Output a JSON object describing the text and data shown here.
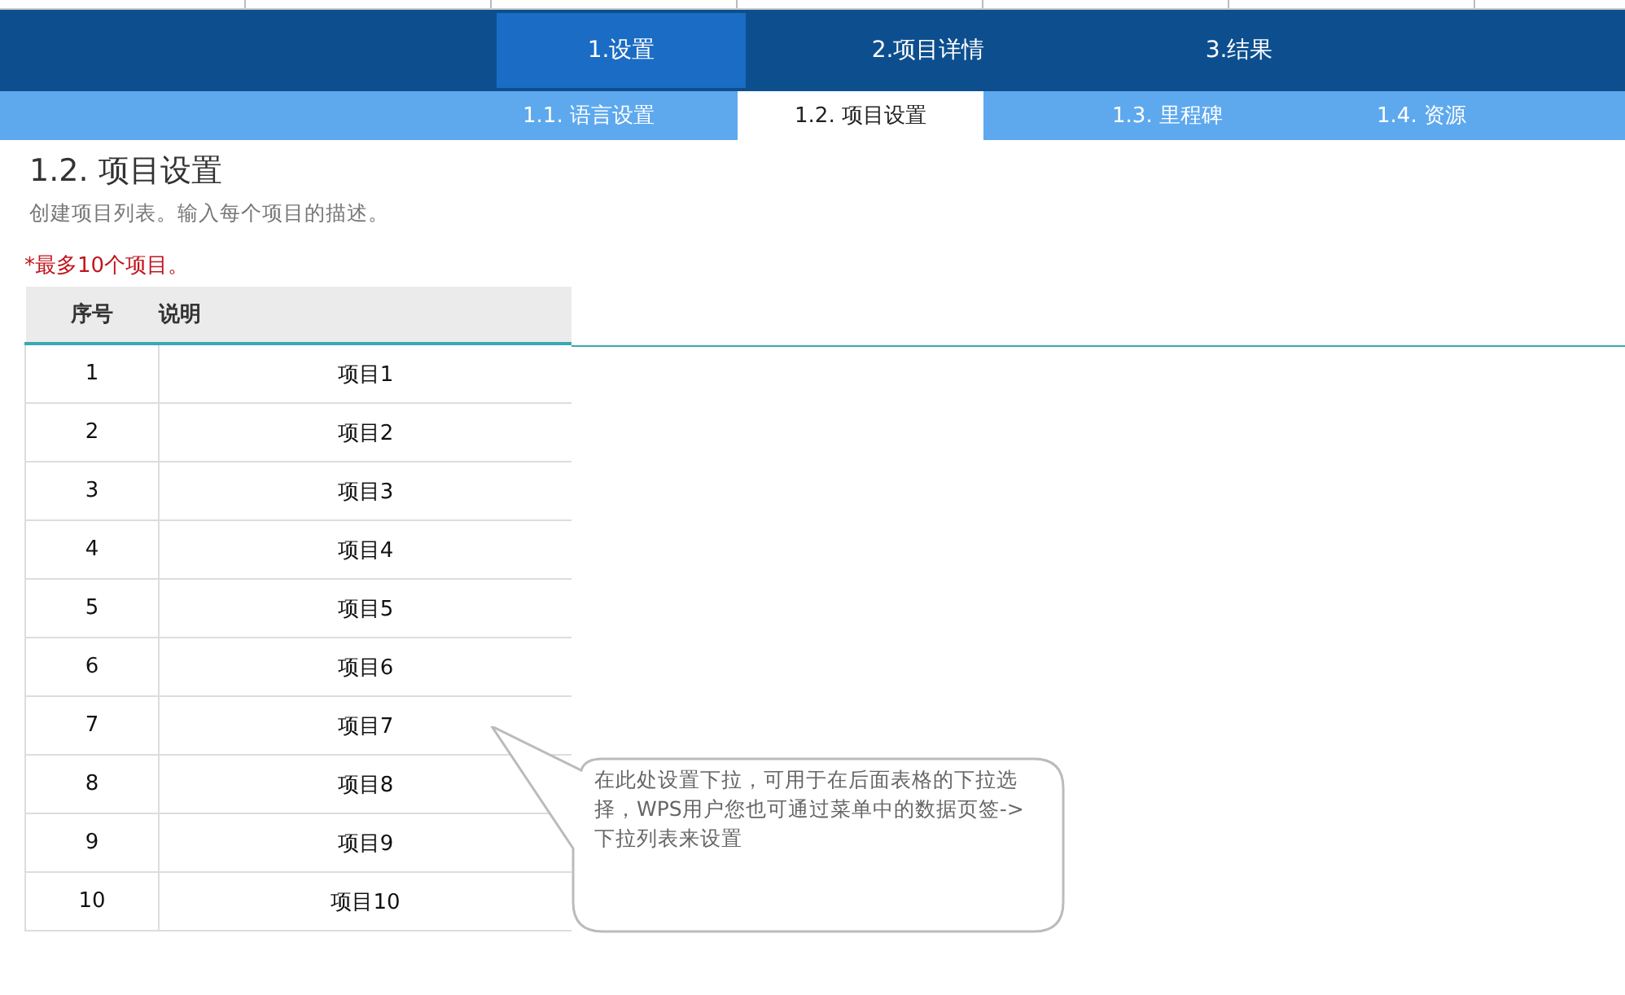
{
  "main_tabs": [
    {
      "label": "1.设置",
      "selected": true
    },
    {
      "label": "2.项目详情",
      "selected": false
    },
    {
      "label": "3.结果",
      "selected": false
    }
  ],
  "sub_tabs": [
    {
      "label": "1.1. 语言设置",
      "selected": false
    },
    {
      "label": "1.2. 项目设置",
      "selected": true
    },
    {
      "label": "1.3. 里程碑",
      "selected": false
    },
    {
      "label": "1.4. 资源",
      "selected": false
    }
  ],
  "heading": "1.2. 项目设置",
  "description": "创建项目列表。输入每个项目的描述。",
  "note": "*最多10个项目。",
  "table": {
    "columns": [
      "序号",
      "说明"
    ],
    "rows": [
      [
        "1",
        "项目1"
      ],
      [
        "2",
        "项目2"
      ],
      [
        "3",
        "项目3"
      ],
      [
        "4",
        "项目4"
      ],
      [
        "5",
        "项目5"
      ],
      [
        "6",
        "项目6"
      ],
      [
        "7",
        "项目7"
      ],
      [
        "8",
        "项目8"
      ],
      [
        "9",
        "项目9"
      ],
      [
        "10",
        "项目10"
      ]
    ]
  },
  "callout": "在此处设置下拉，可用于在后面表格的下拉选择，WPS用户您也可通过菜单中的数据页签->下拉列表来设置"
}
